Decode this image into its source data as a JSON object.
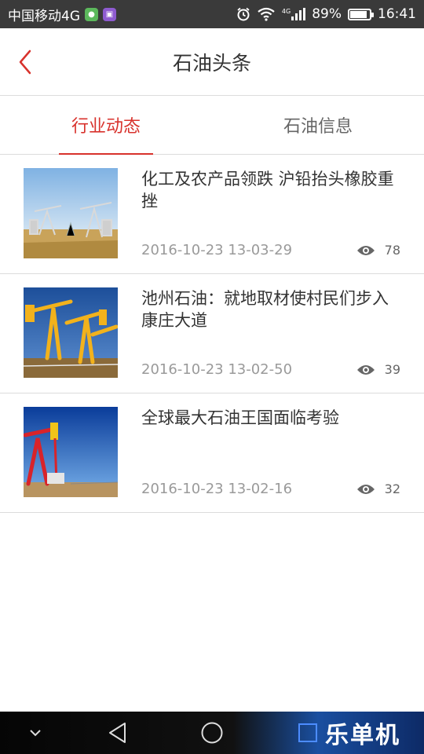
{
  "status_bar": {
    "carrier": "中国移动4G",
    "network": "4G",
    "battery": "89%",
    "battery_level": 0.89,
    "time": "16:41"
  },
  "header": {
    "title": "石油头条",
    "back_icon": "chevron-left-icon"
  },
  "tabs": [
    {
      "label": "行业动态",
      "active": true
    },
    {
      "label": "石油信息",
      "active": false
    }
  ],
  "news": [
    {
      "title": "化工及农产品领跌 沪铅抬头橡胶重挫",
      "date": "2016-10-23 13-03-29",
      "views": "78",
      "image": "oil-pumps-wheat-field"
    },
    {
      "title": "池州石油：就地取材使村民们步入康庄大道",
      "date": "2016-10-23 13-02-50",
      "views": "39",
      "image": "yellow-pumpjacks"
    },
    {
      "title": "全球最大石油王国面临考验",
      "date": "2016-10-23 13-02-16",
      "views": "32",
      "image": "red-pumpjack-desert"
    }
  ],
  "nav_bar": {
    "icons": [
      "chevron-down-icon",
      "back-triangle-icon",
      "home-circle-icon"
    ],
    "watermark": "乐单机"
  },
  "colors": {
    "accent": "#d8322c",
    "status_bar": "#3a3a3a"
  }
}
